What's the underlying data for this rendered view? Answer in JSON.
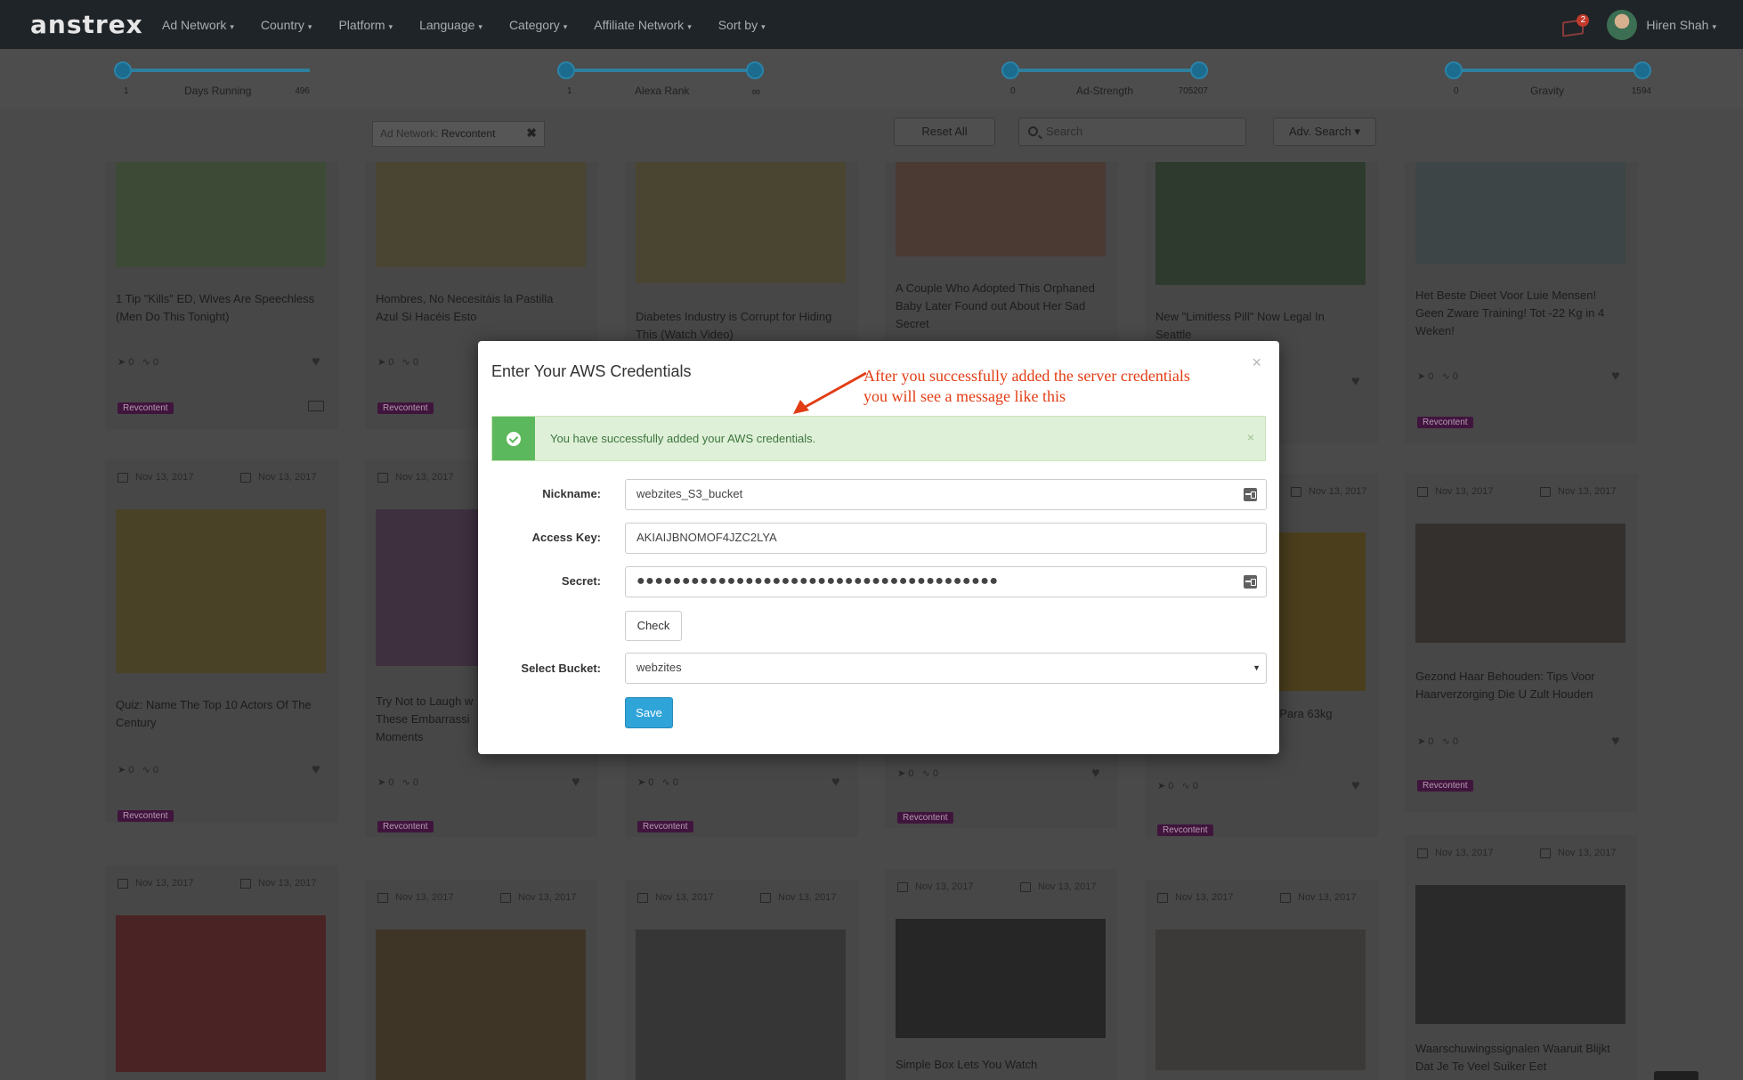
{
  "app": {
    "logo": "anstrex"
  },
  "nav": {
    "items": [
      "Ad Network",
      "Country",
      "Platform",
      "Language",
      "Category",
      "Affiliate Network",
      "Sort by"
    ],
    "caret": "▾",
    "notification_count": "2",
    "user_name": "Hiren Shah"
  },
  "sliders": [
    {
      "label": "Days Running",
      "min": "1",
      "max": "496"
    },
    {
      "label": "Alexa Rank",
      "min": "1",
      "max": "∞"
    },
    {
      "label": "Ad-Strength",
      "min": "0",
      "max": "705207"
    },
    {
      "label": "Gravity",
      "min": "0",
      "max": "1594"
    }
  ],
  "filters": {
    "tag_key": "Ad Network:",
    "tag_value": "Revcontent",
    "tag_close": "✖",
    "reset_label": "Reset All",
    "search_placeholder": "Search",
    "adv_search_label": "Adv. Search ▾"
  },
  "cards": {
    "date": "Nov 13, 2017",
    "badge": "Revcontent",
    "zero": "0",
    "heart": "♥",
    "row1_titles": [
      "1 Tip \"Kills\" ED, Wives Are Speechless (Men Do This Tonight)",
      "Hombres, No Necesitáis la Pastilla Azul Si Hacéis Esto",
      "Diabetes Industry is Corrupt for Hiding This (Watch Video)",
      "A Couple Who Adopted This Orphaned Baby Later Found out About Her Sad Secret",
      "New \"Limitless Pill\" Now Legal In Seattle",
      "Het Beste Dieet Voor Luie Mensen! Geen Zware Training! Tot -22 Kg in 4 Weken!"
    ],
    "row2_titles": [
      "Quiz: Name The Top 10 Actors Of The Century",
      "Try Not to Laugh w These Embarrassi Moments",
      "",
      "",
      "kg Para 63kg",
      "Gezond Haar Behouden: Tips Voor Haarverzorging Die U Zult Houden"
    ],
    "row3_titles": [
      "",
      "",
      "",
      "Simple Box Lets You Watch",
      "",
      "Waarschuwingssignalen Waaruit Blijkt Dat Je Te Veel Suiker Eet"
    ]
  },
  "modal": {
    "title": "Enter Your AWS Credentials",
    "close": "×",
    "annotation_line1": "After you successfully added the server credentials",
    "annotation_line2": "you will see a message like this",
    "alert_message": "You have successfully added your AWS credentials.",
    "alert_close": "×",
    "nickname_label": "Nickname:",
    "nickname_value": "webzites_S3_bucket",
    "access_key_label": "Access Key:",
    "access_key_value": "AKIAIJBNOMOF4JZC2LYA",
    "secret_label": "Secret:",
    "secret_value": "●●●●●●●●●●●●●●●●●●●●●●●●●●●●●●●●●●●●●●●●",
    "check_label": "Check",
    "bucket_label": "Select Bucket:",
    "bucket_value": "webzites",
    "save_label": "Save"
  },
  "colors": {
    "navbar": "#1f2428",
    "alert_bg": "#dff0d8",
    "alert_icon": "#5cb85c",
    "save_button": "#2fa4d9",
    "annotation": "#e23c14",
    "badge": "#40153d"
  }
}
